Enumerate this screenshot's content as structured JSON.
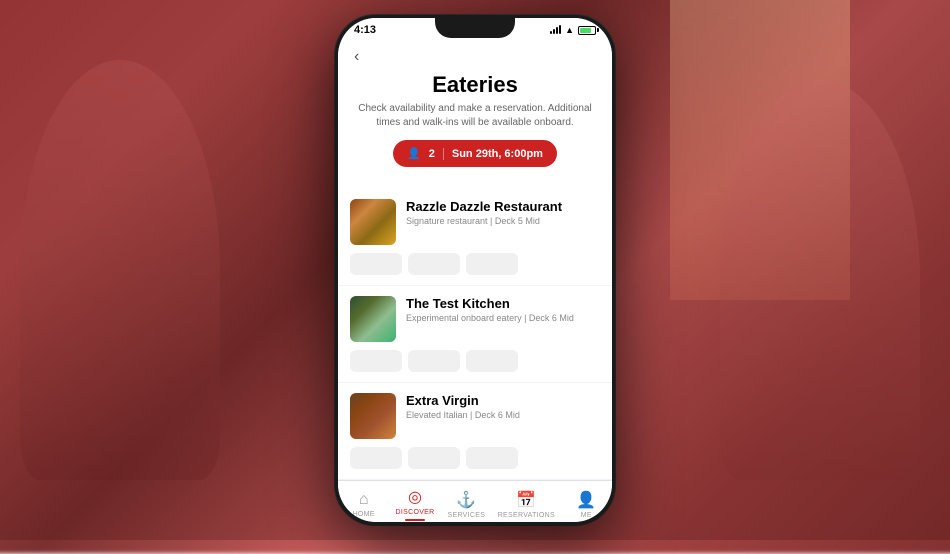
{
  "background": {
    "color_start": "#b04040",
    "color_end": "#803030"
  },
  "phone": {
    "status_bar": {
      "time": "4:13",
      "battery_percent": 80
    },
    "header": {
      "title": "Eateries",
      "subtitle": "Check availability and make a reservation. Additional times and walk-ins will be available onboard.",
      "back_label": "‹"
    },
    "reservation_pill": {
      "guests_icon": "👤",
      "guests_count": "2",
      "date_time": "Sun 29th, 6:00pm"
    },
    "restaurants": [
      {
        "id": "razzle-dazzle",
        "name": "Razzle Dazzle Restaurant",
        "description": "Signature restaurant | Deck 5 Mid",
        "time_slots": [
          "",
          "",
          ""
        ]
      },
      {
        "id": "test-kitchen",
        "name": "The Test Kitchen",
        "description": "Experimental onboard eatery | Deck 6 Mid",
        "time_slots": [
          "",
          "",
          ""
        ]
      },
      {
        "id": "extra-virgin",
        "name": "Extra Virgin",
        "description": "Elevated Italian | Deck 6 Mid",
        "time_slots": [
          "",
          "",
          ""
        ]
      }
    ],
    "bottom_nav": [
      {
        "id": "home",
        "label": "Home",
        "icon": "⌂",
        "active": false
      },
      {
        "id": "discover",
        "label": "Discover",
        "icon": "◎",
        "active": true
      },
      {
        "id": "services",
        "label": "Services",
        "icon": "⚓",
        "active": false
      },
      {
        "id": "reservations",
        "label": "Reservations",
        "icon": "📅",
        "active": false
      },
      {
        "id": "me",
        "label": "Me",
        "icon": "👤",
        "active": false
      }
    ]
  }
}
